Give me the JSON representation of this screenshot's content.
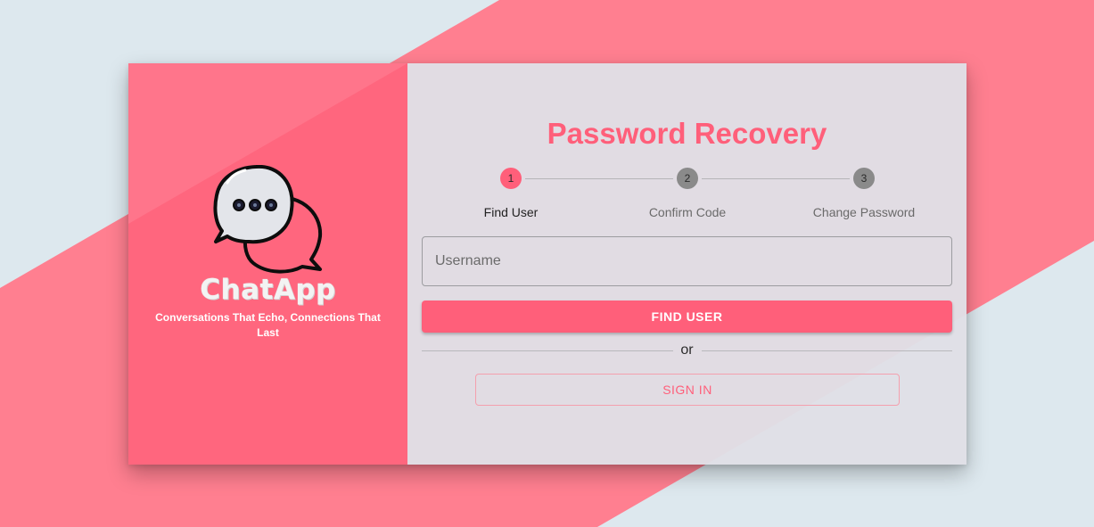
{
  "brand": {
    "name": "ChatApp",
    "tagline": "Conversations That Echo, Connections That Last"
  },
  "form": {
    "title": "Password Recovery",
    "steps": [
      {
        "number": "1",
        "label": "Find User",
        "state": "active"
      },
      {
        "number": "2",
        "label": "Confirm Code",
        "state": "pending"
      },
      {
        "number": "3",
        "label": "Change Password",
        "state": "pending"
      }
    ],
    "username_placeholder": "Username",
    "username_value": "",
    "find_button_label": "FIND USER",
    "divider_text": "or",
    "signin_button_label": "SIGN IN"
  },
  "colors": {
    "accent": "#ff5f7a",
    "brand_panel": "#ff667e",
    "background": "#dde8ee",
    "stripe": "#ff7f90",
    "step_pending": "#8a8a8a"
  },
  "icons": {
    "logo": "chat-bubbles-icon"
  }
}
